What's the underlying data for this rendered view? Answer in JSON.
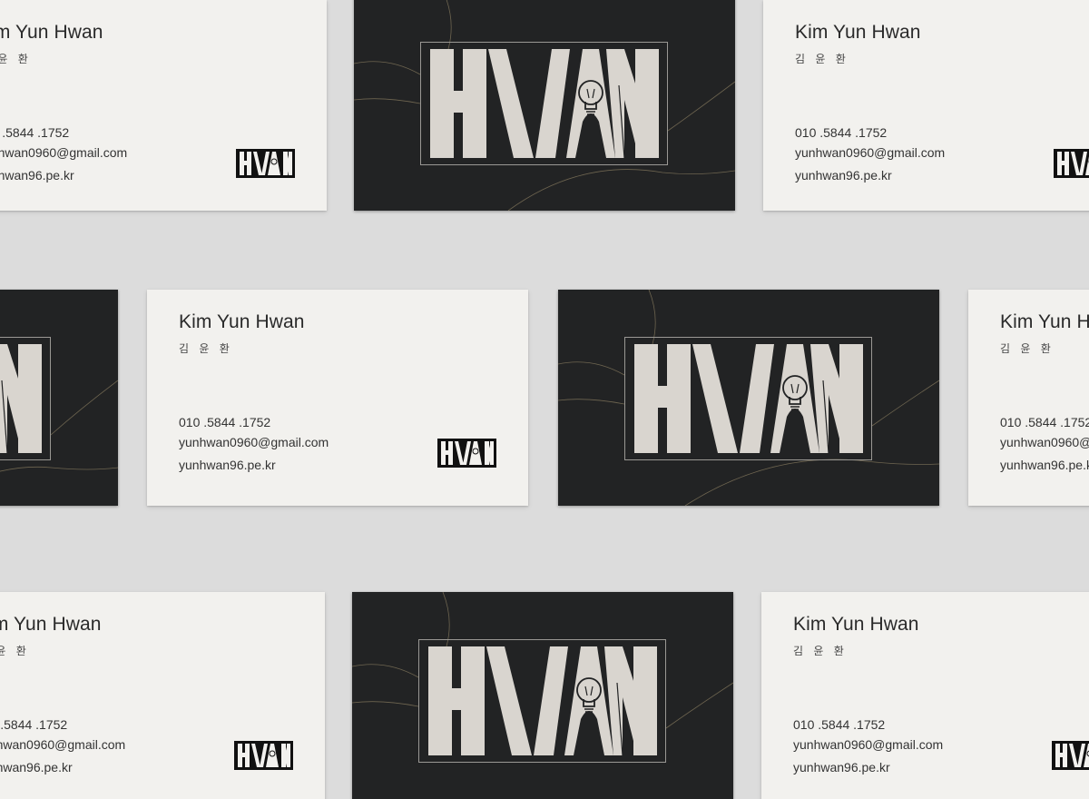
{
  "card": {
    "name": "Kim Yun Hwan",
    "name_korean": "김 윤 환",
    "phone": "010 .5844 .1752",
    "email": "yunhwan0960@gmail.com",
    "website": "yunhwan96.pe.kr",
    "logo_text": "HWAN"
  },
  "colors": {
    "background": "#dcdcdc",
    "card_white": "#f2f1ee",
    "card_dark": "#222324",
    "logo_light": "#d9d5cf",
    "text": "#2a2a2a"
  }
}
